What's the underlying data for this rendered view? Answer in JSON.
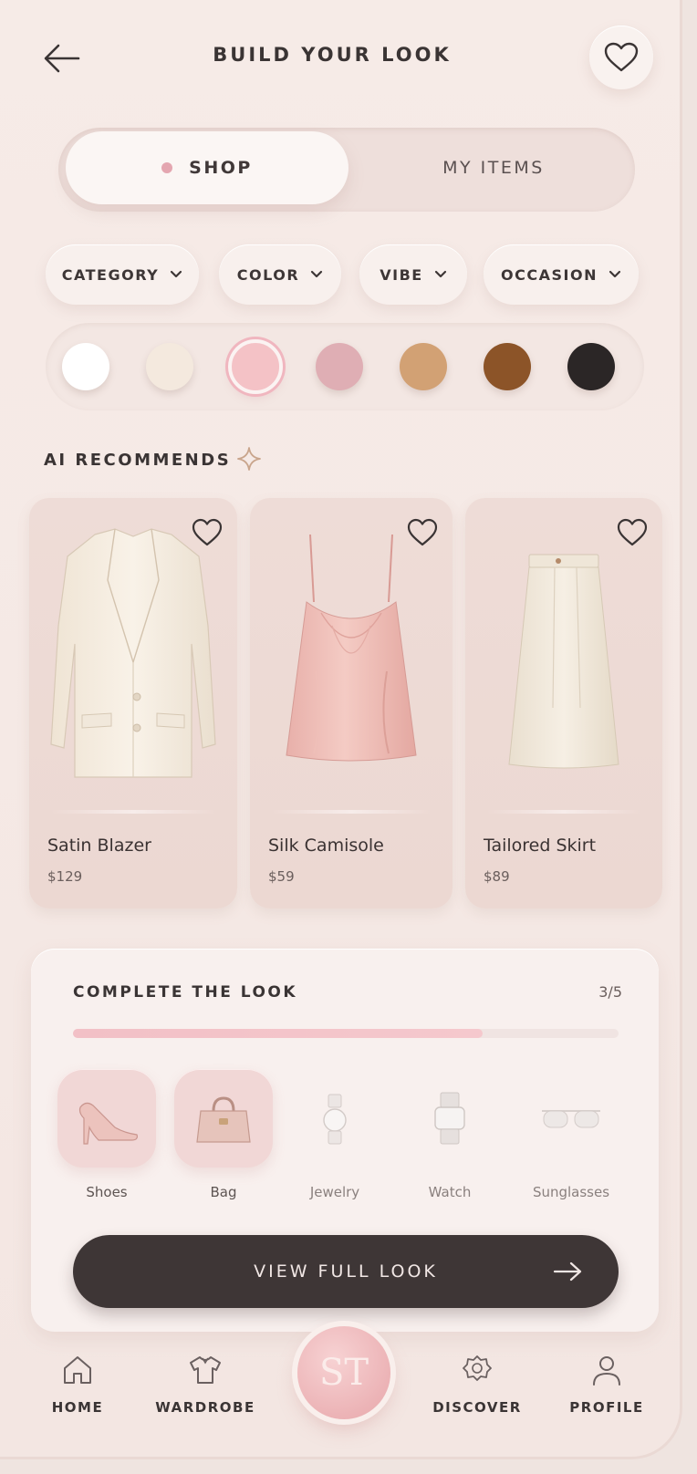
{
  "header": {
    "title": "BUILD YOUR LOOK",
    "back_icon": "arrow-left-icon",
    "favorite_icon": "heart-icon"
  },
  "toggle": {
    "active": "SHOP",
    "shop_label": "SHOP",
    "items_label": "MY ITEMS"
  },
  "filters": [
    {
      "label": "CATEGORY"
    },
    {
      "label": "COLOR"
    },
    {
      "label": "VIBE"
    },
    {
      "label": "OCCASION"
    }
  ],
  "swatches": {
    "colors": [
      "#ffffff",
      "#f4e9de",
      "#f4c2c6",
      "#dfaeb4",
      "#d2a174",
      "#8c5428",
      "#2b2626"
    ],
    "selected_index": 2
  },
  "recommendations": {
    "title": "AI RECOMMENDS",
    "items": [
      {
        "name": "Satin Blazer",
        "price": "$129"
      },
      {
        "name": "Silk Camisole",
        "price": "$59"
      },
      {
        "name": "Tailored Skirt",
        "price": "$89"
      }
    ]
  },
  "complete_look": {
    "title": "COMPLETE THE LOOK",
    "count": "3/5",
    "progress": 0.75,
    "accessories": [
      {
        "label": "Shoes",
        "selected": true
      },
      {
        "label": "Bag",
        "selected": true
      },
      {
        "label": "Jewelry",
        "selected": false
      },
      {
        "label": "Watch",
        "selected": false
      },
      {
        "label": "Sunglasses",
        "selected": false
      }
    ],
    "cta_label": "VIEW FULL LOOK"
  },
  "nav": {
    "items": [
      {
        "label": "HOME",
        "icon": "home-icon"
      },
      {
        "label": "WARDROBE",
        "icon": "wardrobe-icon"
      },
      {
        "label": "DISCOVER",
        "icon": "discover-icon"
      },
      {
        "label": "PROFILE",
        "icon": "profile-icon"
      }
    ],
    "center_monogram": "ST"
  },
  "colors": {
    "accent_pink": "#f0b6bf",
    "cta_dark": "#3e3636",
    "background": "#f5e9e5"
  }
}
